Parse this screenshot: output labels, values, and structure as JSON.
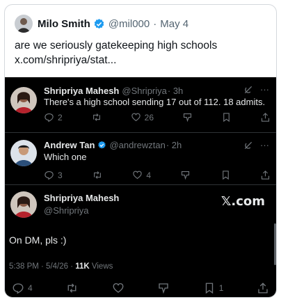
{
  "outer_tweet": {
    "name": "Milo Smith",
    "handle": "@mil000",
    "separator": "·",
    "date": "May 4",
    "text_line1": "are we seriously gatekeeping high schools",
    "text_line2": "x.com/shripriya/stat..."
  },
  "screenshot": {
    "replies": [
      {
        "name": "Shripriya Mahesh",
        "handle": "@Shripriya",
        "time": "· 3h",
        "text": "There's a high school sending 17 out of 112. 18 admits.",
        "reply_count": "2",
        "repost_count": "",
        "like_count": "26",
        "more": "···"
      },
      {
        "name": "Andrew Tan",
        "handle": "@andrewztan",
        "time": "· 2h",
        "text": "Which one",
        "reply_count": "3",
        "repost_count": "",
        "like_count": "4",
        "more": "···"
      }
    ],
    "main": {
      "name": "Shripriya Mahesh",
      "handle": "@Shripriya",
      "logo": "𝕏.com",
      "text": "On DM, pls :)",
      "time": "5:38 PM · 5/4/26 · ",
      "views_count": "11K",
      "views_label": " Views",
      "reply_count": "4",
      "bookmark_count": "1"
    }
  },
  "colors": {
    "verified": "#1d9bf0",
    "dark_bg": "#000000",
    "muted": "#71767b"
  }
}
